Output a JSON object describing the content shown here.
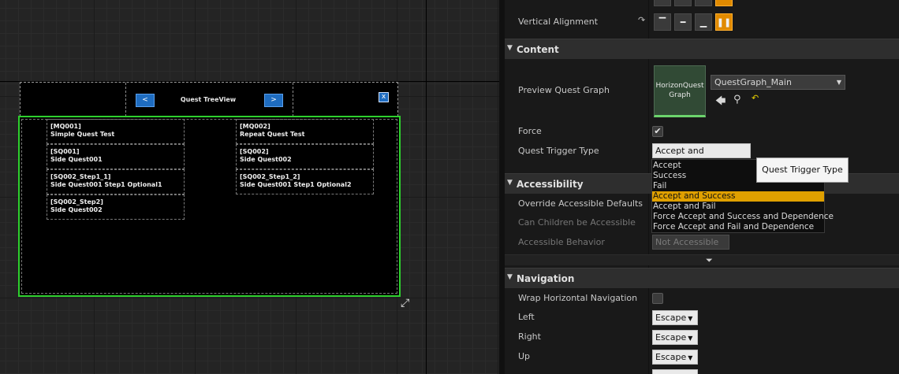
{
  "canvas": {
    "treeview_label": "Quest TreeView",
    "prev_button": "<",
    "next_button": ">",
    "close_button": "x",
    "quest_items": [
      {
        "id": "[MQ001]",
        "name": "Simple Quest Test"
      },
      {
        "id": "[SQ001]",
        "name": "Side Quest001"
      },
      {
        "id": "[SQ002_Step1_1]",
        "name": "Side Quest001 Step1 Optional1"
      },
      {
        "id": "[SQ002_Step2]",
        "name": "Side Quest002"
      },
      {
        "id": "[MQ002]",
        "name": "Repeat Quest Test"
      },
      {
        "id": "[SQ002]",
        "name": "Side Quest002"
      },
      {
        "id": "[SQ002_Step1_2]",
        "name": "Side Quest001 Step1 Optional2"
      }
    ],
    "resize_icon": "move-diagonal-icon"
  },
  "panel": {
    "vertical_alignment": {
      "label": "Vertical Alignment",
      "options": [
        "top-align-icon",
        "center-align-icon",
        "bottom-align-icon",
        "fill-align-icon"
      ],
      "active": 3
    },
    "content": {
      "title": "Content",
      "preview_quest_graph": {
        "label": "Preview Quest Graph",
        "thumbnail_text": "HorizonQuest Graph",
        "selected": "QuestGraph_Main"
      },
      "force": {
        "label": "Force",
        "checked": true
      },
      "quest_trigger_type": {
        "label": "Quest Trigger Type",
        "value": "Accept and Success",
        "options": [
          "Accept",
          "Success",
          "Fail",
          "Accept and Success",
          "Accept and Fail",
          "Force Accept and Success and Dependence",
          "Force Accept and Fail and Dependence"
        ],
        "selected_index": 3,
        "tooltip": "Quest Trigger Type"
      }
    },
    "accessibility": {
      "title": "Accessibility",
      "override_label": "Override Accessible Defaults",
      "children_label": "Can Children be Accessible",
      "behavior_label": "Accessible Behavior",
      "behavior_value": "Not Accessible"
    },
    "navigation": {
      "title": "Navigation",
      "wrap_label": "Wrap Horizontal Navigation",
      "rows": [
        {
          "label": "Left",
          "value": "Escape"
        },
        {
          "label": "Right",
          "value": "Escape"
        },
        {
          "label": "Up",
          "value": "Escape"
        }
      ]
    },
    "accent_color": "#e08a00",
    "selection_color": "#2ed02e"
  }
}
